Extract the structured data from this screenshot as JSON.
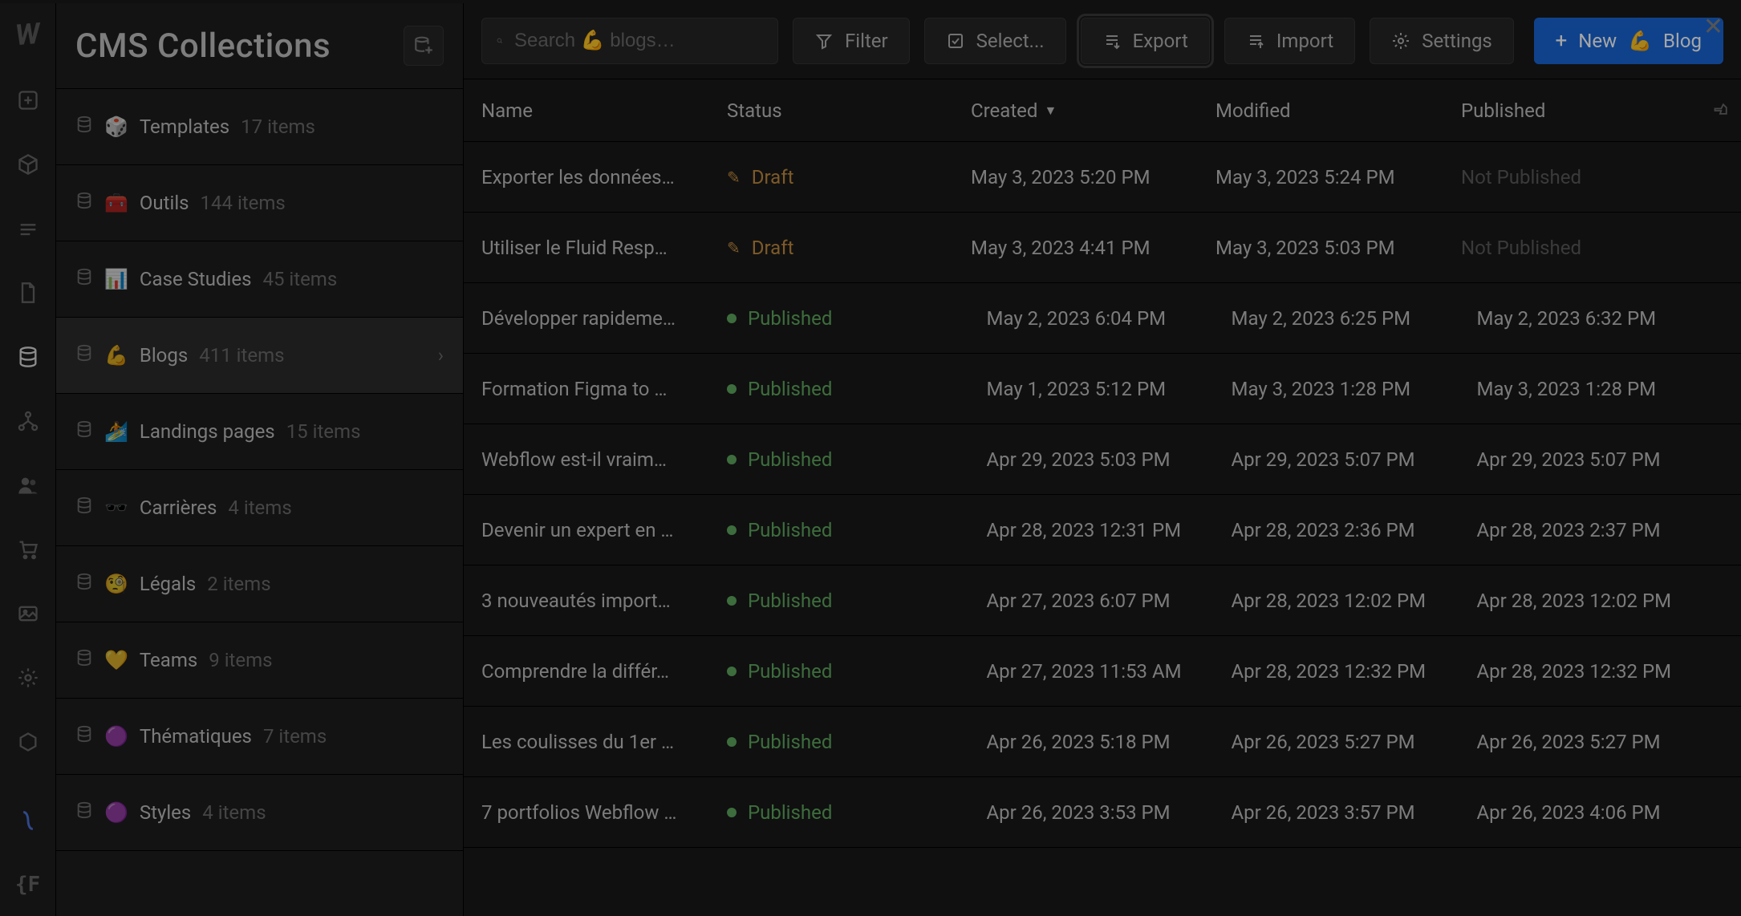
{
  "header": {
    "title": "CMS Collections"
  },
  "search": {
    "placeholder": "Search 💪 blogs…"
  },
  "toolbar": {
    "filter": "Filter",
    "select": "Select...",
    "export": "Export",
    "import": "Import",
    "settings": "Settings",
    "new_prefix": "New",
    "new_emoji": "💪",
    "new_label": "Blog"
  },
  "columns": {
    "name": "Name",
    "status": "Status",
    "created": "Created",
    "modified": "Modified",
    "published": "Published"
  },
  "status_labels": {
    "draft": "Draft",
    "published": "Published",
    "not_published": "Not Published"
  },
  "collections": [
    {
      "emoji": "🎲",
      "name": "Templates",
      "count": "17 items"
    },
    {
      "emoji": "🧰",
      "name": "Outils",
      "count": "144 items"
    },
    {
      "emoji": "📊",
      "name": "Case Studies",
      "count": "45 items"
    },
    {
      "emoji": "💪",
      "name": "Blogs",
      "count": "411 items",
      "active": true
    },
    {
      "emoji": "🏄",
      "name": "Landings pages",
      "count": "15 items"
    },
    {
      "emoji": "🕶️",
      "name": "Carrières",
      "count": "4 items"
    },
    {
      "emoji": "🧐",
      "name": "Légals",
      "count": "2 items"
    },
    {
      "emoji": "💛",
      "name": "Teams",
      "count": "9 items"
    },
    {
      "emoji": "🟣",
      "name": "Thématiques",
      "count": "7 items"
    },
    {
      "emoji": "🟣",
      "name": "Styles",
      "count": "4 items"
    }
  ],
  "rows": [
    {
      "name": "Exporter les données…",
      "status": "draft",
      "created": "May 3, 2023 5:20 PM",
      "modified": "May 3, 2023 5:24 PM",
      "published": "Not Published"
    },
    {
      "name": "Utiliser le Fluid Resp…",
      "status": "draft",
      "created": "May 3, 2023 4:41 PM",
      "modified": "May 3, 2023 5:03 PM",
      "published": "Not Published"
    },
    {
      "name": "Développer rapideme…",
      "status": "published",
      "created": "May 2, 2023 6:04 PM",
      "modified": "May 2, 2023 6:25 PM",
      "published": "May 2, 2023 6:32 PM"
    },
    {
      "name": "Formation Figma to …",
      "status": "published",
      "created": "May 1, 2023 5:12 PM",
      "modified": "May 3, 2023 1:28 PM",
      "published": "May 3, 2023 1:28 PM"
    },
    {
      "name": "Webflow est-il vraim…",
      "status": "published",
      "created": "Apr 29, 2023 5:03 PM",
      "modified": "Apr 29, 2023 5:07 PM",
      "published": "Apr 29, 2023 5:07 PM"
    },
    {
      "name": "Devenir un expert en …",
      "status": "published",
      "created": "Apr 28, 2023 12:31 PM",
      "modified": "Apr 28, 2023 2:36 PM",
      "published": "Apr 28, 2023 2:37 PM"
    },
    {
      "name": "3 nouveautés import…",
      "status": "published",
      "created": "Apr 27, 2023 6:07 PM",
      "modified": "Apr 28, 2023 12:02 PM",
      "published": "Apr 28, 2023 12:02 PM"
    },
    {
      "name": "Comprendre la différ…",
      "status": "published",
      "created": "Apr 27, 2023 11:53 AM",
      "modified": "Apr 28, 2023 12:32 PM",
      "published": "Apr 28, 2023 12:32 PM"
    },
    {
      "name": "Les coulisses du 1er …",
      "status": "published",
      "created": "Apr 26, 2023 5:18 PM",
      "modified": "Apr 26, 2023 5:27 PM",
      "published": "Apr 26, 2023 5:27 PM"
    },
    {
      "name": "7 portfolios Webflow …",
      "status": "published",
      "created": "Apr 26, 2023 3:53 PM",
      "modified": "Apr 26, 2023 3:57 PM",
      "published": "Apr 26, 2023 4:06 PM"
    }
  ]
}
